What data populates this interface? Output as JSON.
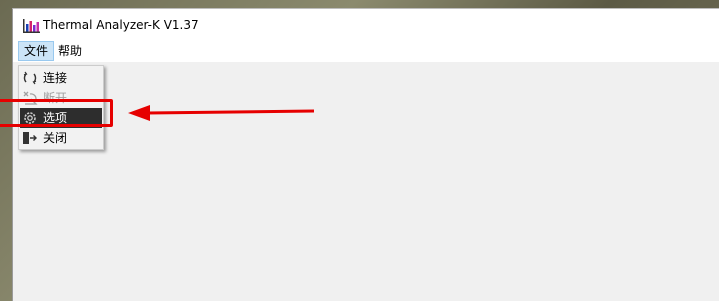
{
  "window": {
    "title": "Thermal Analyzer-K V1.37"
  },
  "menubar": {
    "file_label": "文件",
    "help_label": "帮助"
  },
  "file_menu": {
    "items": [
      {
        "label": "连接",
        "icon": "connect-icon",
        "enabled": true
      },
      {
        "label": "断开",
        "icon": "disconnect-icon",
        "enabled": false
      },
      {
        "label": "选项",
        "icon": "gear-icon",
        "enabled": true,
        "selected": true
      },
      {
        "label": "关闭",
        "icon": "exit-icon",
        "enabled": true
      }
    ]
  },
  "annotation": {
    "color": "#e60000"
  },
  "colors": {
    "menu_selected_bg": "#2d2d2d",
    "menu_hover_bg": "#cce4f7",
    "client_bg": "#f0f0f0"
  }
}
